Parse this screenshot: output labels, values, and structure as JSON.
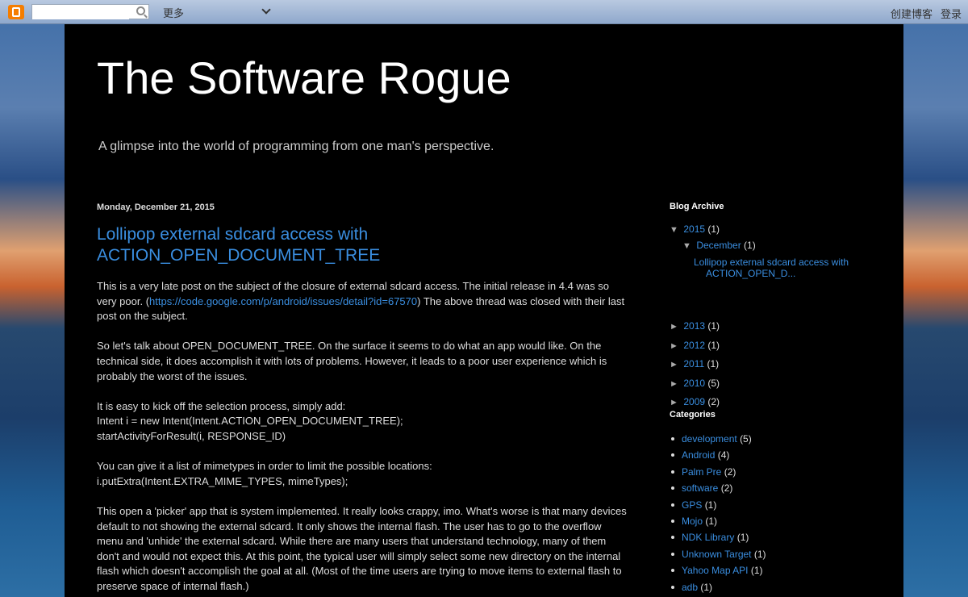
{
  "navbar": {
    "search_placeholder": "",
    "more_label": "更多",
    "create_blog_label": "创建博客",
    "login_label": "登录"
  },
  "blog": {
    "title": "The Software Rogue",
    "description": "A glimpse into the world of programming from one man's perspective."
  },
  "post": {
    "date": "Monday, December 21, 2015",
    "title": "Lollipop external sdcard access with ACTION_OPEN_DOCUMENT_TREE",
    "p1_before": "This is a very late post on the subject of the closure of external sdcard access.  The initial release in 4.4 was so very poor.  (",
    "p1_link": "https://code.google.com/p/android/issues/detail?id=67570",
    "p1_after": ")  The above thread was closed with their last post on the subject.",
    "p2": "So let's talk about OPEN_DOCUMENT_TREE.  On the surface it seems to do what an app would like.  On the technical side, it does accomplish it with lots of problems.  However, it leads to a poor user experience which is probably the worst of the issues.",
    "p3_line1": "It is easy to kick off the selection process, simply add:",
    "p3_line2": "Intent i = new Intent(Intent.ACTION_OPEN_DOCUMENT_TREE);",
    "p3_line3": "startActivityForResult(i, RESPONSE_ID)",
    "p4_line1": "You can give it a list of mimetypes in order to limit the possible locations:",
    "p4_line2": "i.putExtra(Intent.EXTRA_MIME_TYPES, mimeTypes);",
    "p5": "This open a 'picker' app that is system implemented.  It really looks crappy, imo.  What's worse is that many devices default to not showing the external sdcard.  It only shows the internal flash.  The user has to go to the overflow menu and 'unhide' the external sdcard.  While there are many users that understand technology, many of them don't and would not expect this.  At this point, the typical user will simply select some new directory on the internal flash which doesn't accomplish the goal at all.  (Most of the time users are trying to move items to external flash to preserve space of internal flash.)"
  },
  "archive": {
    "title": "Blog Archive",
    "year_2015": {
      "toggle": "▼",
      "label": "2015",
      "count": "(1)"
    },
    "month_dec": {
      "toggle": "▼",
      "label": "December",
      "count": "(1)"
    },
    "post_link_line1": "Lollipop external sdcard access with",
    "post_link_line2": "ACTION_OPEN_D...",
    "years": [
      {
        "toggle": "►",
        "label": "2013",
        "count": "(1)"
      },
      {
        "toggle": "►",
        "label": "2012",
        "count": "(1)"
      },
      {
        "toggle": "►",
        "label": "2011",
        "count": "(1)"
      },
      {
        "toggle": "►",
        "label": "2010",
        "count": "(5)"
      },
      {
        "toggle": "►",
        "label": "2009",
        "count": "(2)"
      }
    ]
  },
  "categories": {
    "title": "Categories",
    "items": [
      {
        "label": "development",
        "count": "(5)"
      },
      {
        "label": "Android",
        "count": "(4)"
      },
      {
        "label": "Palm Pre",
        "count": "(2)"
      },
      {
        "label": "software",
        "count": "(2)"
      },
      {
        "label": "GPS",
        "count": "(1)"
      },
      {
        "label": "Mojo",
        "count": "(1)"
      },
      {
        "label": "NDK Library",
        "count": "(1)"
      },
      {
        "label": "Unknown Target",
        "count": "(1)"
      },
      {
        "label": "Yahoo Map API",
        "count": "(1)"
      },
      {
        "label": "adb",
        "count": "(1)"
      }
    ]
  }
}
